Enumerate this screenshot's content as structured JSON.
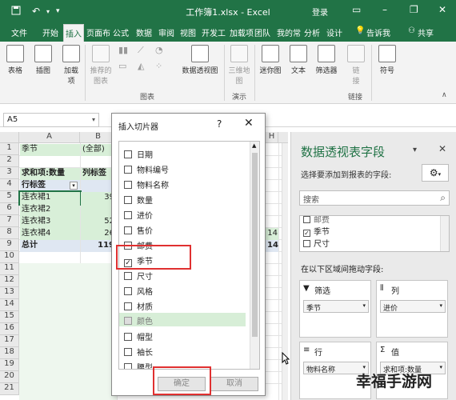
{
  "window": {
    "title": "工作簿1.xlsx - Excel",
    "login": "登录",
    "minimize": "–",
    "restore": "❐",
    "close": "✕",
    "save_icon": "save-icon",
    "undo_icon": "undo-icon",
    "redo_icon": "redo-icon"
  },
  "tabs": [
    "文件",
    "开始",
    "插入",
    "页面布",
    "公式",
    "数据",
    "审阅",
    "视图",
    "开发工",
    "加载项",
    "团队",
    "我的常",
    "分析",
    "设计"
  ],
  "tell_me": "告诉我",
  "share": "共享",
  "ribbon": {
    "table": "表格",
    "illustrations": "插图",
    "addins": "加载\n项",
    "rec_charts": "推荐的\n图表",
    "pivot_chart": "数据透视图",
    "map3d": "三维地\n图",
    "sparklines": "迷你图",
    "text": "文本",
    "filter": "筛选器",
    "link": "链\n接",
    "symbols": "符号",
    "group_charts": "图表",
    "group_tours": "演示",
    "group_links": "链接"
  },
  "namebox": "A5",
  "col_headers": [
    "A",
    "B",
    "H"
  ],
  "sheet": {
    "r1a": "季节",
    "r1b": "(全部)",
    "r3a": "求和项:数量",
    "r3b": "列标签",
    "r4a": "行标签",
    "r5a": "连衣裙1",
    "r5b": "39",
    "r6a": "连衣裙2",
    "r7a": "连衣裙3",
    "r7b": "52",
    "r8a": "连衣裙4",
    "r8b": "26",
    "r8h": "14",
    "r9a": "总计",
    "r9b": "119",
    "r9h": "14"
  },
  "row_numbers": [
    "1",
    "2",
    "3",
    "4",
    "5",
    "6",
    "7",
    "8",
    "9",
    "10",
    "11",
    "12",
    "13",
    "14",
    "15",
    "16",
    "17",
    "18",
    "19",
    "20",
    "21"
  ],
  "dialog": {
    "title": "插入切片器",
    "help": "?",
    "close": "✕",
    "items": [
      "日期",
      "物料编号",
      "物料名称",
      "数量",
      "进价",
      "售价",
      "邮费",
      "季节",
      "尺寸",
      "风格",
      "材质",
      "颜色",
      "帽型",
      "袖长",
      "腰型"
    ],
    "ok": "确定",
    "cancel": "取消"
  },
  "pane": {
    "title": "数据透视表字段",
    "subtitle": "选择要添加到报表的字段:",
    "search": "搜索",
    "fields": [
      "邮费",
      "季节",
      "尺寸"
    ],
    "drag_label": "在以下区域间拖动字段:",
    "filter_title": "筛选",
    "filter_chip": "季节",
    "columns_title": "列",
    "columns_chip": "进价",
    "rows_title": "行",
    "rows_chip": "物料名称",
    "values_title": "值",
    "values_chip": "求和项:数量",
    "close": "✕"
  },
  "watermark": "幸福手游网"
}
